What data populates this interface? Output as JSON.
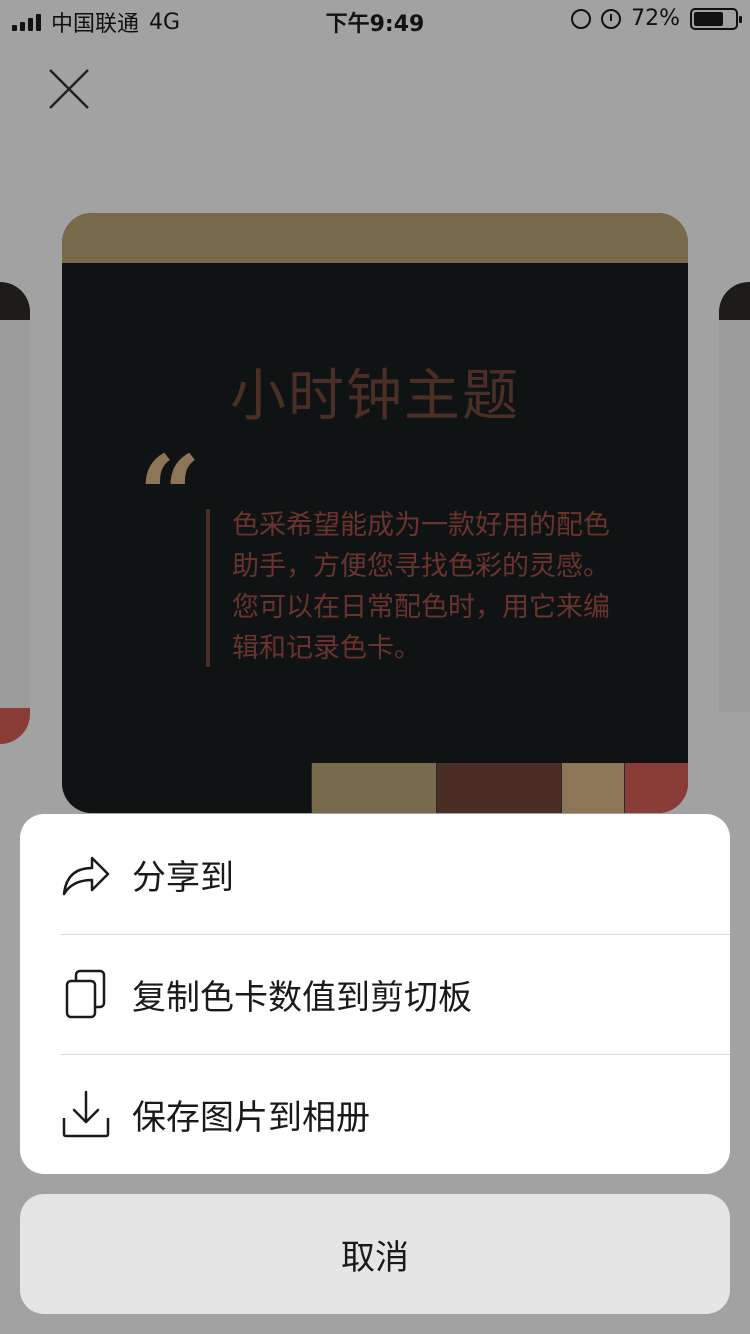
{
  "status_bar": {
    "carrier": "中国联通",
    "network": "4G",
    "time": "下午9:49",
    "battery_percent": "72%",
    "battery_level": 0.72
  },
  "card": {
    "title": "小时钟主题",
    "quote_mark": "“",
    "quote_text": "色采希望能成为一款好用的配色助手，方便您寻找色彩的灵感。您可以在日常配色时，用它来编辑和记录色卡。",
    "colors": {
      "top_band": "#776b4b",
      "background": "#0f1314",
      "title": "#4b2e25",
      "quote_mark": "#8d7557",
      "quote_text": "#6a332c"
    },
    "swatches": [
      {
        "color": "#0f1314",
        "fraction": 0.398
      },
      {
        "color": "#776b4b",
        "fraction": 0.2
      },
      {
        "color": "#4b2e25",
        "fraction": 0.2
      },
      {
        "color": "#8d7557",
        "fraction": 0.1
      },
      {
        "color": "#8a3c37",
        "fraction": 0.102
      }
    ]
  },
  "action_sheet": {
    "items": [
      {
        "label": "分享到",
        "icon": "share-icon"
      },
      {
        "label": "复制色卡数值到剪切板",
        "icon": "copy-icon"
      },
      {
        "label": "保存图片到相册",
        "icon": "download-icon"
      }
    ],
    "cancel_label": "取消"
  }
}
